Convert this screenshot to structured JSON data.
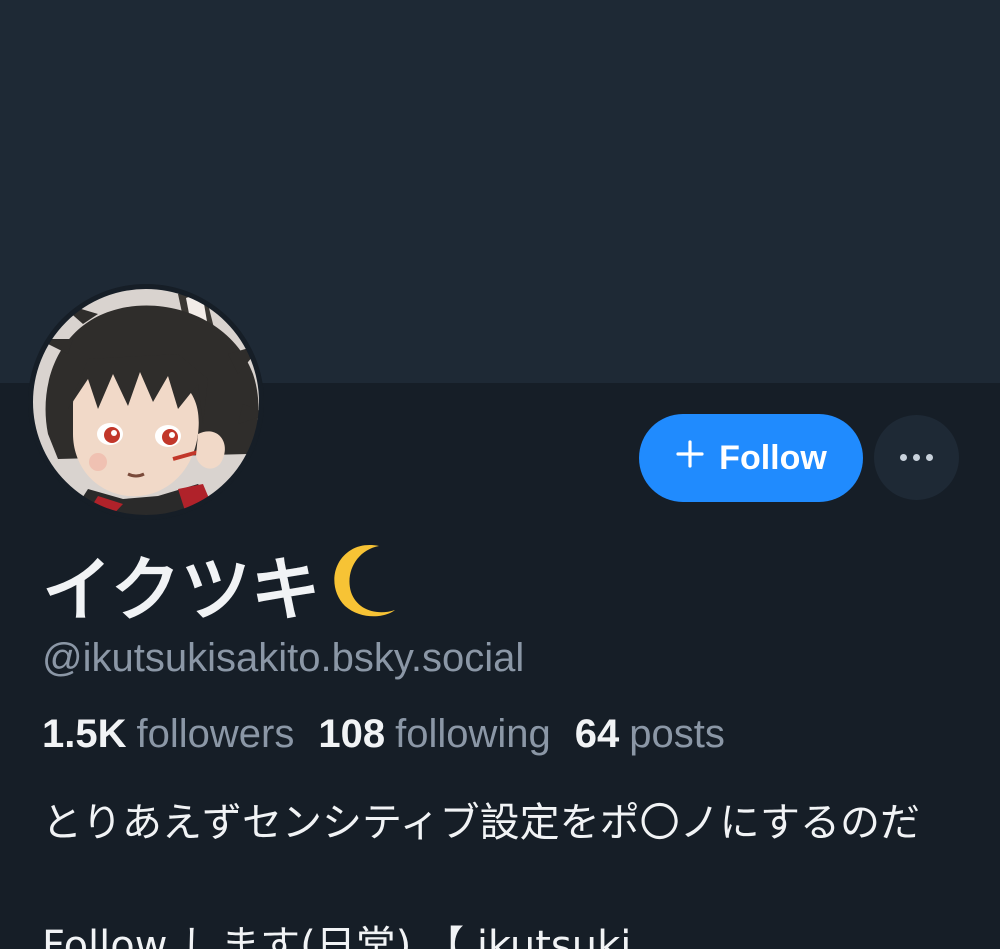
{
  "profile": {
    "display_name": "イクツキ",
    "name_icon": "crescent-moon-icon",
    "handle": "@ikutsukisakito.bsky.social",
    "avatar_icon": "avatar-illustration",
    "stats": {
      "followers_count": "1.5K",
      "followers_label": "followers",
      "following_count": "108",
      "following_label": "following",
      "posts_count": "64",
      "posts_label": "posts"
    },
    "bio": "とりあえずセンシティブ設定をポ〇ノにするのだ",
    "bio_next_line": "Follow します(日常) 【 ikutsuki"
  },
  "actions": {
    "follow_label": "Follow",
    "follow_icon": "plus-icon",
    "more_icon": "ellipsis-icon"
  },
  "colors": {
    "accent": "#208bfe",
    "background": "#161e27",
    "banner": "#1e2935",
    "muted_text": "#8b97a6"
  }
}
